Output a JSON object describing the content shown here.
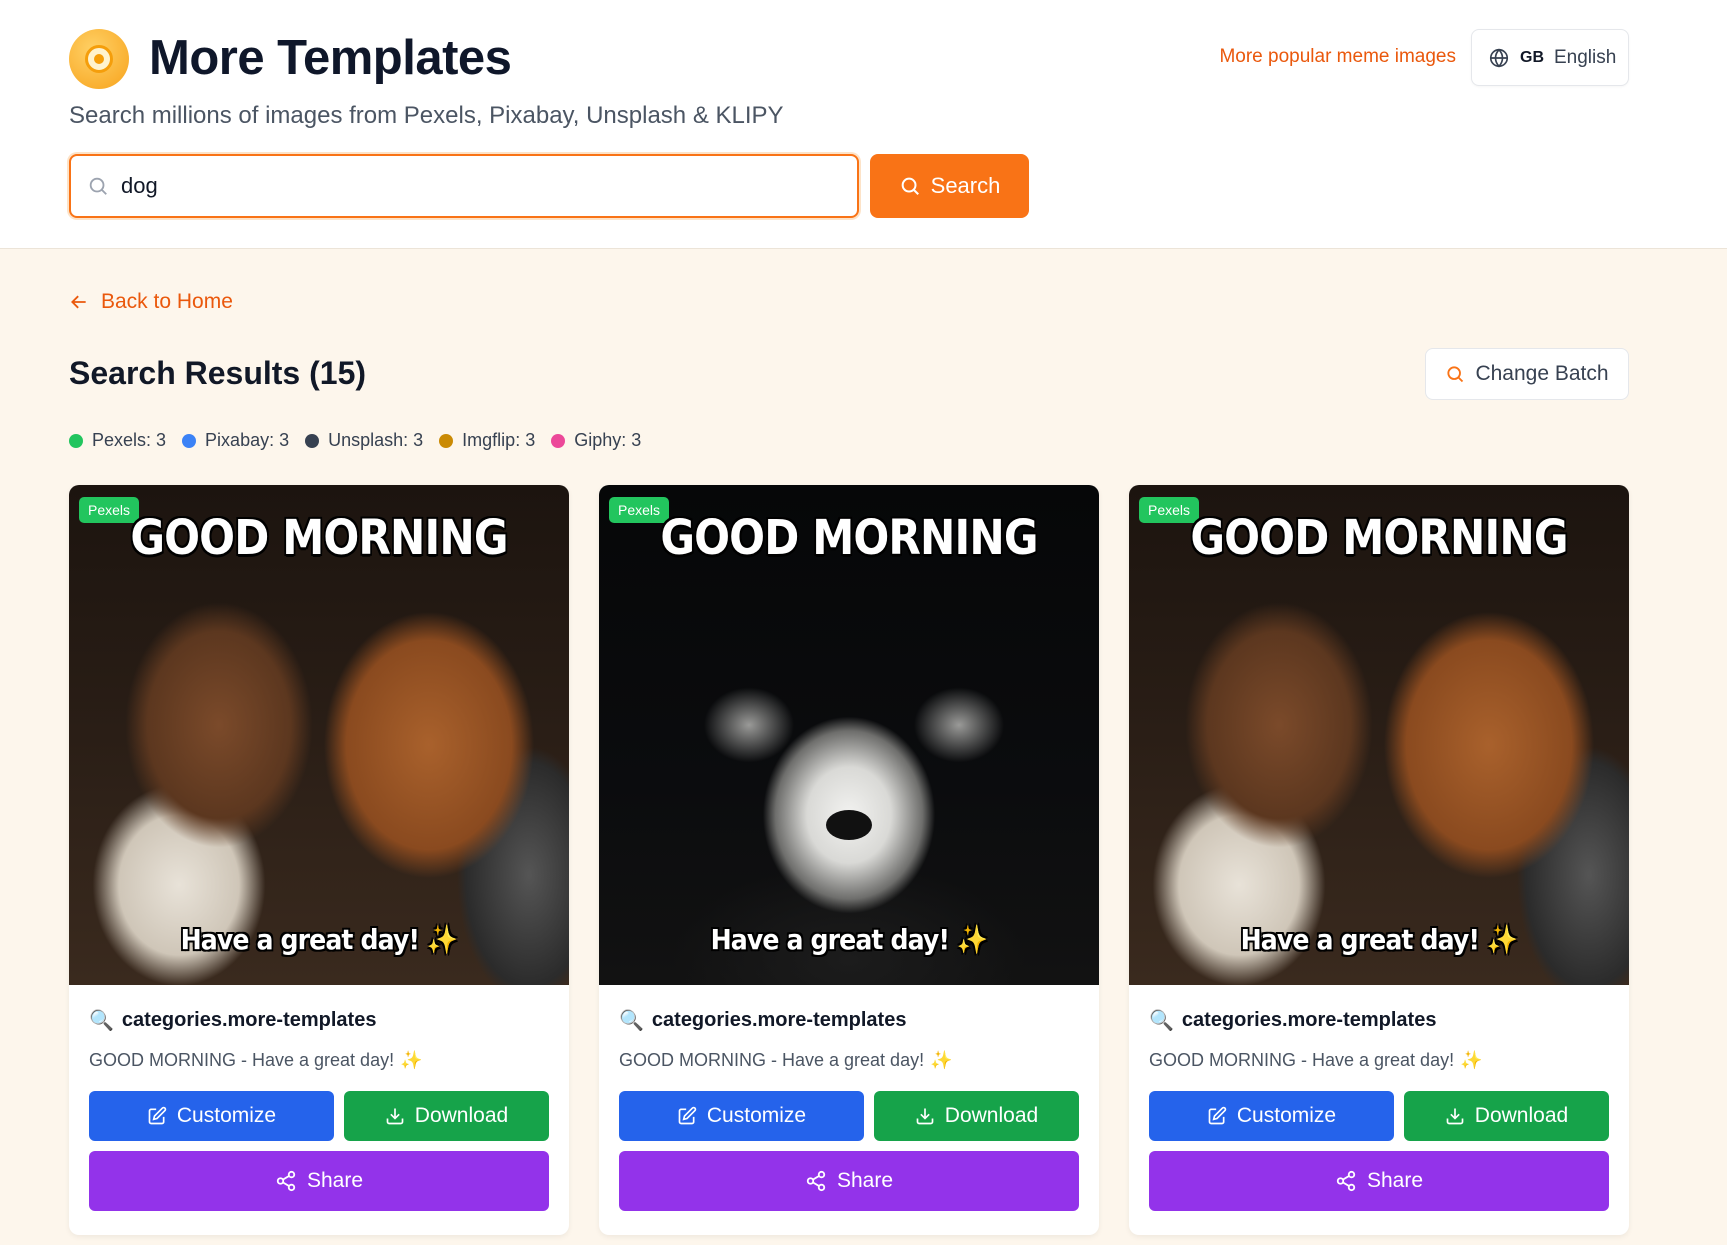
{
  "header": {
    "title": "More Templates",
    "subtitle": "Search millions of images from Pexels, Pixabay, Unsplash & KLIPY",
    "popular_link": "More popular meme images",
    "language_code": "GB",
    "language_label": "English"
  },
  "search": {
    "value": "dog",
    "button_label": "Search",
    "icon": "search-icon"
  },
  "nav": {
    "back_label": "Back to Home"
  },
  "results": {
    "title": "Search Results (15)",
    "change_batch_label": "Change Batch"
  },
  "sources": [
    {
      "label": "Pexels: 3",
      "color": "#22c55e"
    },
    {
      "label": "Pixabay: 3",
      "color": "#3b82f6"
    },
    {
      "label": "Unsplash: 3",
      "color": "#374151"
    },
    {
      "label": "Imgflip: 3",
      "color": "#ca8a04"
    },
    {
      "label": "Giphy: 3",
      "color": "#ec4899"
    }
  ],
  "cards": [
    {
      "badge": "Pexels",
      "meme_top": "GOOD MORNING",
      "meme_bottom": "Have a great day!",
      "title": "categories.more-templates",
      "description": "GOOD MORNING - Have a great day!",
      "customize_label": "Customize",
      "download_label": "Download",
      "share_label": "Share"
    },
    {
      "badge": "Pexels",
      "meme_top": "GOOD MORNING",
      "meme_bottom": "Have a great day!",
      "title": "categories.more-templates",
      "description": "GOOD MORNING - Have a great day!",
      "customize_label": "Customize",
      "download_label": "Download",
      "share_label": "Share"
    },
    {
      "badge": "Pexels",
      "meme_top": "GOOD MORNING",
      "meme_bottom": "Have a great day!",
      "title": "categories.more-templates",
      "description": "GOOD MORNING - Have a great day!",
      "customize_label": "Customize",
      "download_label": "Download",
      "share_label": "Share"
    }
  ],
  "colors": {
    "accent": "#f97316",
    "customize": "#2563eb",
    "download": "#16a34a",
    "share": "#9333ea",
    "badge": "#22c55e"
  }
}
